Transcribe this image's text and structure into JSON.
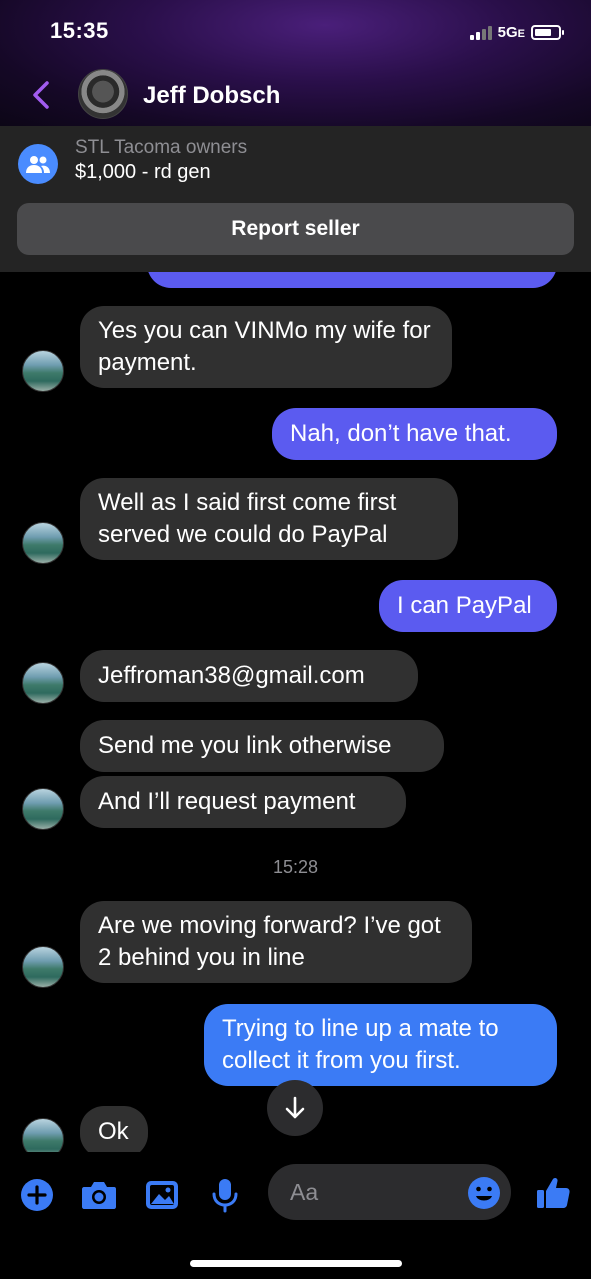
{
  "status_bar": {
    "time": "15:35",
    "network": "5G",
    "network_suffix": "E"
  },
  "header": {
    "contact_name": "Jeff Dobsch"
  },
  "listing": {
    "group_name": "STL Tacoma owners",
    "price_title": "$1,000 - rd gen",
    "report_label": "Report seller"
  },
  "messages": [
    {
      "direction": "incoming",
      "text": "Yes you can VINMo my wife for payment."
    },
    {
      "direction": "outgoing",
      "text": "Nah, don’t have that."
    },
    {
      "direction": "incoming",
      "text": "Well as I said first come first served we could do PayPal"
    },
    {
      "direction": "outgoing",
      "text": "I can PayPal"
    },
    {
      "direction": "incoming",
      "text": "Jeffroman38@gmail.com"
    },
    {
      "direction": "incoming",
      "text": "Send me you link otherwise"
    },
    {
      "direction": "incoming",
      "text": "And I’ll request payment"
    },
    {
      "type": "timestamp",
      "text": "15:28"
    },
    {
      "direction": "incoming",
      "text": "Are we moving forward?   I’ve got 2 behind you in line"
    },
    {
      "direction": "outgoing",
      "text": "Trying to line up a mate to collect it from you first."
    },
    {
      "direction": "incoming",
      "text": "Ok"
    }
  ],
  "composer": {
    "placeholder": "Aa",
    "icons": [
      "add-icon",
      "camera-icon",
      "image-icon",
      "microphone-icon",
      "emoji-icon",
      "thumbs-up-icon"
    ]
  },
  "colors": {
    "accent": "#5b5bf0",
    "outgoing_blue": "#3b7bf5",
    "incoming_bubble": "#303030",
    "icon_blue": "#3b7bf5",
    "back_purple": "#a25cf0"
  }
}
